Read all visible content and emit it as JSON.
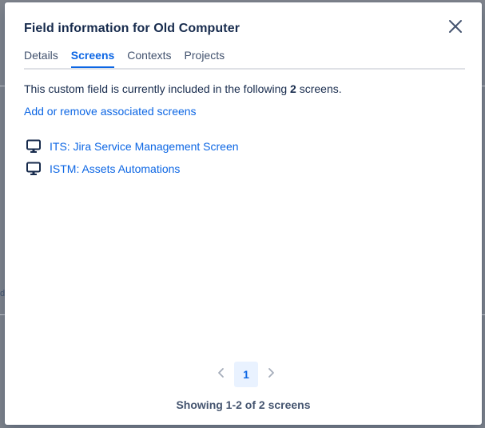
{
  "background": {
    "fragment_text": "d"
  },
  "dialog": {
    "title": "Field information for Old Computer",
    "close_icon": "close-icon",
    "tabs": [
      {
        "label": "Details",
        "active": false
      },
      {
        "label": "Screens",
        "active": true
      },
      {
        "label": "Contexts",
        "active": false
      },
      {
        "label": "Projects",
        "active": false
      }
    ],
    "description": {
      "prefix": "This custom field is currently included in the following ",
      "count": "2",
      "suffix": " screens."
    },
    "add_link": "Add or remove associated screens",
    "screens": [
      {
        "icon": "monitor-icon",
        "name": "ITS: Jira Service Management Screen"
      },
      {
        "icon": "monitor-icon",
        "name": "ISTM: Assets Automations"
      }
    ],
    "pagination": {
      "prev_icon": "chevron-left-icon",
      "current_page": "1",
      "next_icon": "chevron-right-icon"
    },
    "showing_text": "Showing 1-2 of 2 screens"
  },
  "colors": {
    "link": "#0c66e4",
    "text": "#172b4d",
    "subtle": "#44546f",
    "tab_border": "#dfe1e6",
    "page_selected_bg": "#e9f2ff"
  }
}
